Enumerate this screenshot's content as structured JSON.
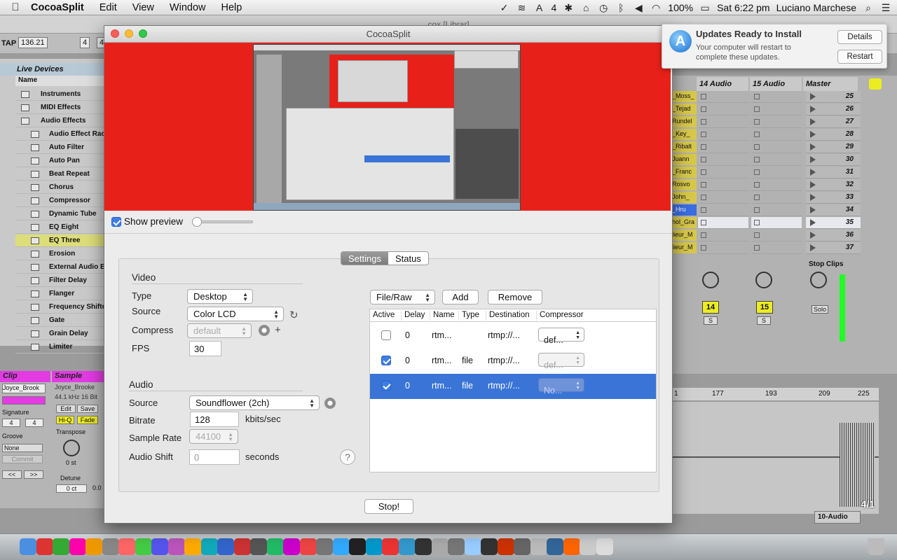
{
  "menubar": {
    "app_name": "CocoaSplit",
    "menus": [
      "Edit",
      "View",
      "Window",
      "Help"
    ],
    "battery": "100%",
    "clock": "Sat 6:22 pm",
    "user": "Luciano Marchese",
    "status_icons": [
      "time-machine-icon",
      "layers-icon",
      "adobe-icon",
      "bluetooth-icon",
      "volume-icon",
      "wifi-icon"
    ],
    "count_badge": "4"
  },
  "notification": {
    "title": "Updates Ready to Install",
    "body": "Your computer will restart to complete these updates.",
    "details_label": "Details",
    "restart_label": "Restart"
  },
  "background_app": {
    "window_title": "cox  [Librar]",
    "tempo": "136.21",
    "sig_a": "4",
    "sig_b": "4",
    "tap": "TAP",
    "browser_header": "Live Devices",
    "name_header": "Name",
    "top_items": [
      "Instruments",
      "MIDI Effects",
      "Audio Effects"
    ],
    "effects": [
      "Audio Effect Rac",
      "Auto Filter",
      "Auto Pan",
      "Beat Repeat",
      "Chorus",
      "Compressor",
      "Dynamic Tube",
      "EQ Eight",
      "EQ Three",
      "Erosion",
      "External Audio E",
      "Filter Delay",
      "Flanger",
      "Frequency Shifte",
      "Gate",
      "Grain Delay",
      "Limiter"
    ],
    "selected_effect": "EQ Three",
    "tracks": [
      "14 Audio",
      "15 Audio",
      "Master"
    ],
    "clip_names": [
      "_Moss_",
      "_Tejad",
      "Rundel",
      "_Key_",
      "_Ribalt",
      "Juann",
      "_Franc",
      "Rosvo",
      "John_",
      "_Hru",
      "hol_Gra",
      "lieur_M",
      "lieur_M"
    ],
    "scenes": [
      "25",
      "26",
      "27",
      "28",
      "29",
      "30",
      "31",
      "32",
      "33",
      "34",
      "35",
      "36",
      "37"
    ],
    "selected_scene": "35",
    "stop_clips": "Stop Clips",
    "track_nums": [
      "14",
      "15"
    ],
    "solo": "Solo",
    "s_label": "S",
    "ruler": [
      "177",
      "193",
      "209",
      "225"
    ],
    "ruler_start": "1",
    "bar_count": "4/1",
    "output": "10-Audio",
    "clip_panel": {
      "clip": "Clip",
      "sample": "Sample",
      "clip_name": "Joyce_Brook",
      "sample_name": "Joyce_Brooke",
      "sample_info": "44.1 kHz 16 Bit",
      "signature": "Signature",
      "sig_a": "4",
      "sig_b": "4",
      "groove": "Groove",
      "groove_val": "None",
      "commit": "Commit",
      "edit": "Edit",
      "save": "Save",
      "hiq": "Hi-Q",
      "fade": "Fade",
      "transpose": "Transpose",
      "transpose_val": "0 st",
      "detune": "Detune",
      "detune_val": "0 ct",
      "nudge_left": "<<",
      "nudge_right": ">>",
      "extra_val": "0.0"
    }
  },
  "window": {
    "title": "CocoaSplit",
    "show_preview_label": "Show preview",
    "show_preview_checked": true,
    "preview_level": 0.0,
    "tabs": [
      "Settings",
      "Status"
    ],
    "active_tab": "Settings",
    "video": {
      "heading": "Video",
      "type_label": "Type",
      "type_value": "Desktop",
      "source_label": "Source",
      "source_value": "Color LCD",
      "compress_label": "Compress",
      "compress_value": "default",
      "fps_label": "FPS",
      "fps_value": "30"
    },
    "audio": {
      "heading": "Audio",
      "source_label": "Source",
      "source_value": "Soundflower (2ch)",
      "bitrate_label": "Bitrate",
      "bitrate_value": "128",
      "bitrate_unit": "kbits/sec",
      "sample_rate_label": "Sample Rate",
      "sample_rate_value": "44100",
      "shift_label": "Audio Shift",
      "shift_value": "0",
      "shift_unit": "seconds",
      "help": "?"
    },
    "outputs": {
      "format_value": "File/Raw",
      "add_label": "Add",
      "remove_label": "Remove",
      "columns": [
        "Active",
        "Delay",
        "Name",
        "Type",
        "Destination",
        "Compressor"
      ],
      "rows": [
        {
          "active": false,
          "delay": "0",
          "name": "rtm...",
          "type": "",
          "destination": "rtmp://...",
          "compressor": "def...",
          "compressor_enabled": true,
          "selected": false
        },
        {
          "active": true,
          "delay": "0",
          "name": "rtm...",
          "type": "file",
          "destination": "rtmp://...",
          "compressor": "def...",
          "compressor_enabled": false,
          "selected": false
        },
        {
          "active": true,
          "delay": "0",
          "name": "rtm...",
          "type": "file",
          "destination": "rtmp://...",
          "compressor": "No...",
          "compressor_enabled": false,
          "selected": true
        }
      ]
    },
    "stop_label": "Stop!",
    "add_icon": "+",
    "refresh_icon": "↻"
  },
  "colors": {
    "preview_red": "#e8201a",
    "selection_blue": "#3a74d6",
    "ableton_yellow": "#ecec22",
    "ableton_magenta": "#e23be3"
  }
}
